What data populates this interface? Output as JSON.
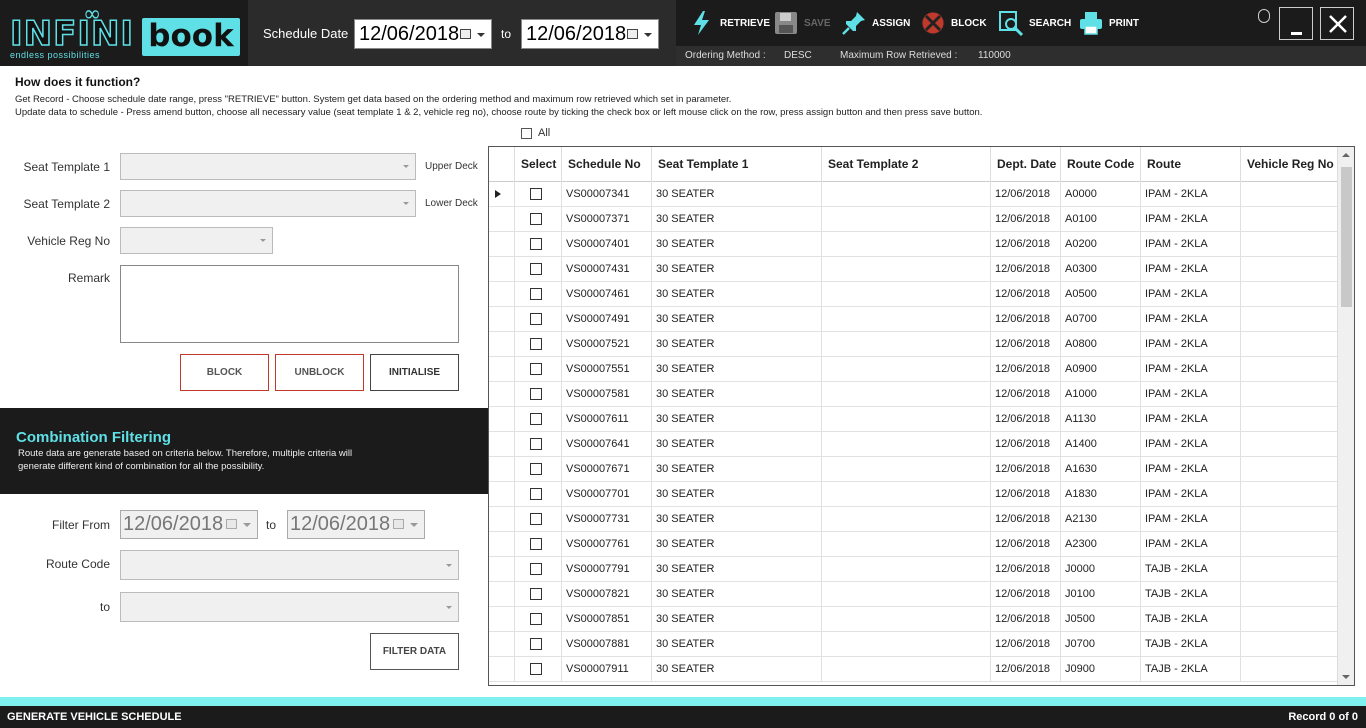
{
  "logo": {
    "main": "INFINI",
    "loop": "∞",
    "book": "book",
    "tagline": "endless possibilities"
  },
  "schedule": {
    "label": "Schedule Date",
    "from": "12/06/2018",
    "to_label": "to",
    "to": "12/06/2018"
  },
  "toolbar": {
    "retrieve": "RETRIEVE",
    "save": "SAVE",
    "assign": "ASSIGN",
    "block": "BLOCK",
    "search": "SEARCH",
    "print": "PRINT"
  },
  "infobar": {
    "ordering_label": "Ordering Method :",
    "ordering_value": "DESC",
    "maxrow_label": "Maximum Row Retrieved :",
    "maxrow_value": "110000"
  },
  "help": {
    "title": "How does it function?",
    "line1": "Get Record - Choose schedule date range, press \"RETRIEVE\" button. System get data based on the ordering method and maximum row retrieved which set in parameter.",
    "line2": "Update data to schedule - Press amend button, choose all necessary value (seat template 1 & 2, vehicle reg no), choose route by ticking the check box or left mouse click on the row, press assign button and then press save button."
  },
  "form": {
    "seat1_label": "Seat Template 1",
    "upper_deck": "Upper Deck",
    "seat2_label": "Seat Template 2",
    "lower_deck": "Lower Deck",
    "vehicle_label": "Vehicle Reg No",
    "remark_label": "Remark",
    "block_btn": "BLOCK",
    "unblock_btn": "UNBLOCK",
    "initialise_btn": "INITIALISE"
  },
  "combination": {
    "title": "Combination Filtering",
    "desc1": "Route data are generate based on criteria below. Therefore, multiple criteria will",
    "desc2": "generate different kind of combination for all the possibility."
  },
  "filter": {
    "from_label": "Filter From",
    "from": "12/06/2018",
    "to_label": "to",
    "to": "12/06/2018",
    "route_label": "Route Code",
    "route_to_label": "to",
    "filter_btn": "FILTER DATA"
  },
  "grid": {
    "all_label": "All",
    "headers": [
      "Select",
      "Schedule No",
      "Seat Template 1",
      "Seat Template 2",
      "Dept. Date",
      "Route Code",
      "Route",
      "Vehicle Reg No"
    ],
    "rows": [
      [
        "VS00007341",
        "30 SEATER",
        "",
        "12/06/2018",
        "A0000",
        "IPAM  -  2KLA",
        ""
      ],
      [
        "VS00007371",
        "30 SEATER",
        "",
        "12/06/2018",
        "A0100",
        "IPAM  -  2KLA",
        ""
      ],
      [
        "VS00007401",
        "30 SEATER",
        "",
        "12/06/2018",
        "A0200",
        "IPAM  -  2KLA",
        ""
      ],
      [
        "VS00007431",
        "30 SEATER",
        "",
        "12/06/2018",
        "A0300",
        "IPAM  -  2KLA",
        ""
      ],
      [
        "VS00007461",
        "30 SEATER",
        "",
        "12/06/2018",
        "A0500",
        "IPAM  -  2KLA",
        ""
      ],
      [
        "VS00007491",
        "30 SEATER",
        "",
        "12/06/2018",
        "A0700",
        "IPAM  -  2KLA",
        ""
      ],
      [
        "VS00007521",
        "30 SEATER",
        "",
        "12/06/2018",
        "A0800",
        "IPAM  -  2KLA",
        ""
      ],
      [
        "VS00007551",
        "30 SEATER",
        "",
        "12/06/2018",
        "A0900",
        "IPAM  -  2KLA",
        ""
      ],
      [
        "VS00007581",
        "30 SEATER",
        "",
        "12/06/2018",
        "A1000",
        "IPAM  -  2KLA",
        ""
      ],
      [
        "VS00007611",
        "30 SEATER",
        "",
        "12/06/2018",
        "A1130",
        "IPAM  -  2KLA",
        ""
      ],
      [
        "VS00007641",
        "30 SEATER",
        "",
        "12/06/2018",
        "A1400",
        "IPAM  -  2KLA",
        ""
      ],
      [
        "VS00007671",
        "30 SEATER",
        "",
        "12/06/2018",
        "A1630",
        "IPAM  -  2KLA",
        ""
      ],
      [
        "VS00007701",
        "30 SEATER",
        "",
        "12/06/2018",
        "A1830",
        "IPAM  -  2KLA",
        ""
      ],
      [
        "VS00007731",
        "30 SEATER",
        "",
        "12/06/2018",
        "A2130",
        "IPAM  -  2KLA",
        ""
      ],
      [
        "VS00007761",
        "30 SEATER",
        "",
        "12/06/2018",
        "A2300",
        "IPAM  -  2KLA",
        ""
      ],
      [
        "VS00007791",
        "30 SEATER",
        "",
        "12/06/2018",
        "J0000",
        "TAJB  -  2KLA",
        ""
      ],
      [
        "VS00007821",
        "30 SEATER",
        "",
        "12/06/2018",
        "J0100",
        "TAJB  -  2KLA",
        ""
      ],
      [
        "VS00007851",
        "30 SEATER",
        "",
        "12/06/2018",
        "J0500",
        "TAJB  -  2KLA",
        ""
      ],
      [
        "VS00007881",
        "30 SEATER",
        "",
        "12/06/2018",
        "J0700",
        "TAJB  -  2KLA",
        ""
      ],
      [
        "VS00007911",
        "30 SEATER",
        "",
        "12/06/2018",
        "J0900",
        "TAJB  -  2KLA",
        ""
      ]
    ]
  },
  "footer": {
    "title": "GENERATE VEHICLE SCHEDULE",
    "record": "Record 0 of 0"
  },
  "colors": {
    "accent": "#5fe0e6",
    "dark": "#1b1b1b",
    "block_red": "#c0392b"
  }
}
